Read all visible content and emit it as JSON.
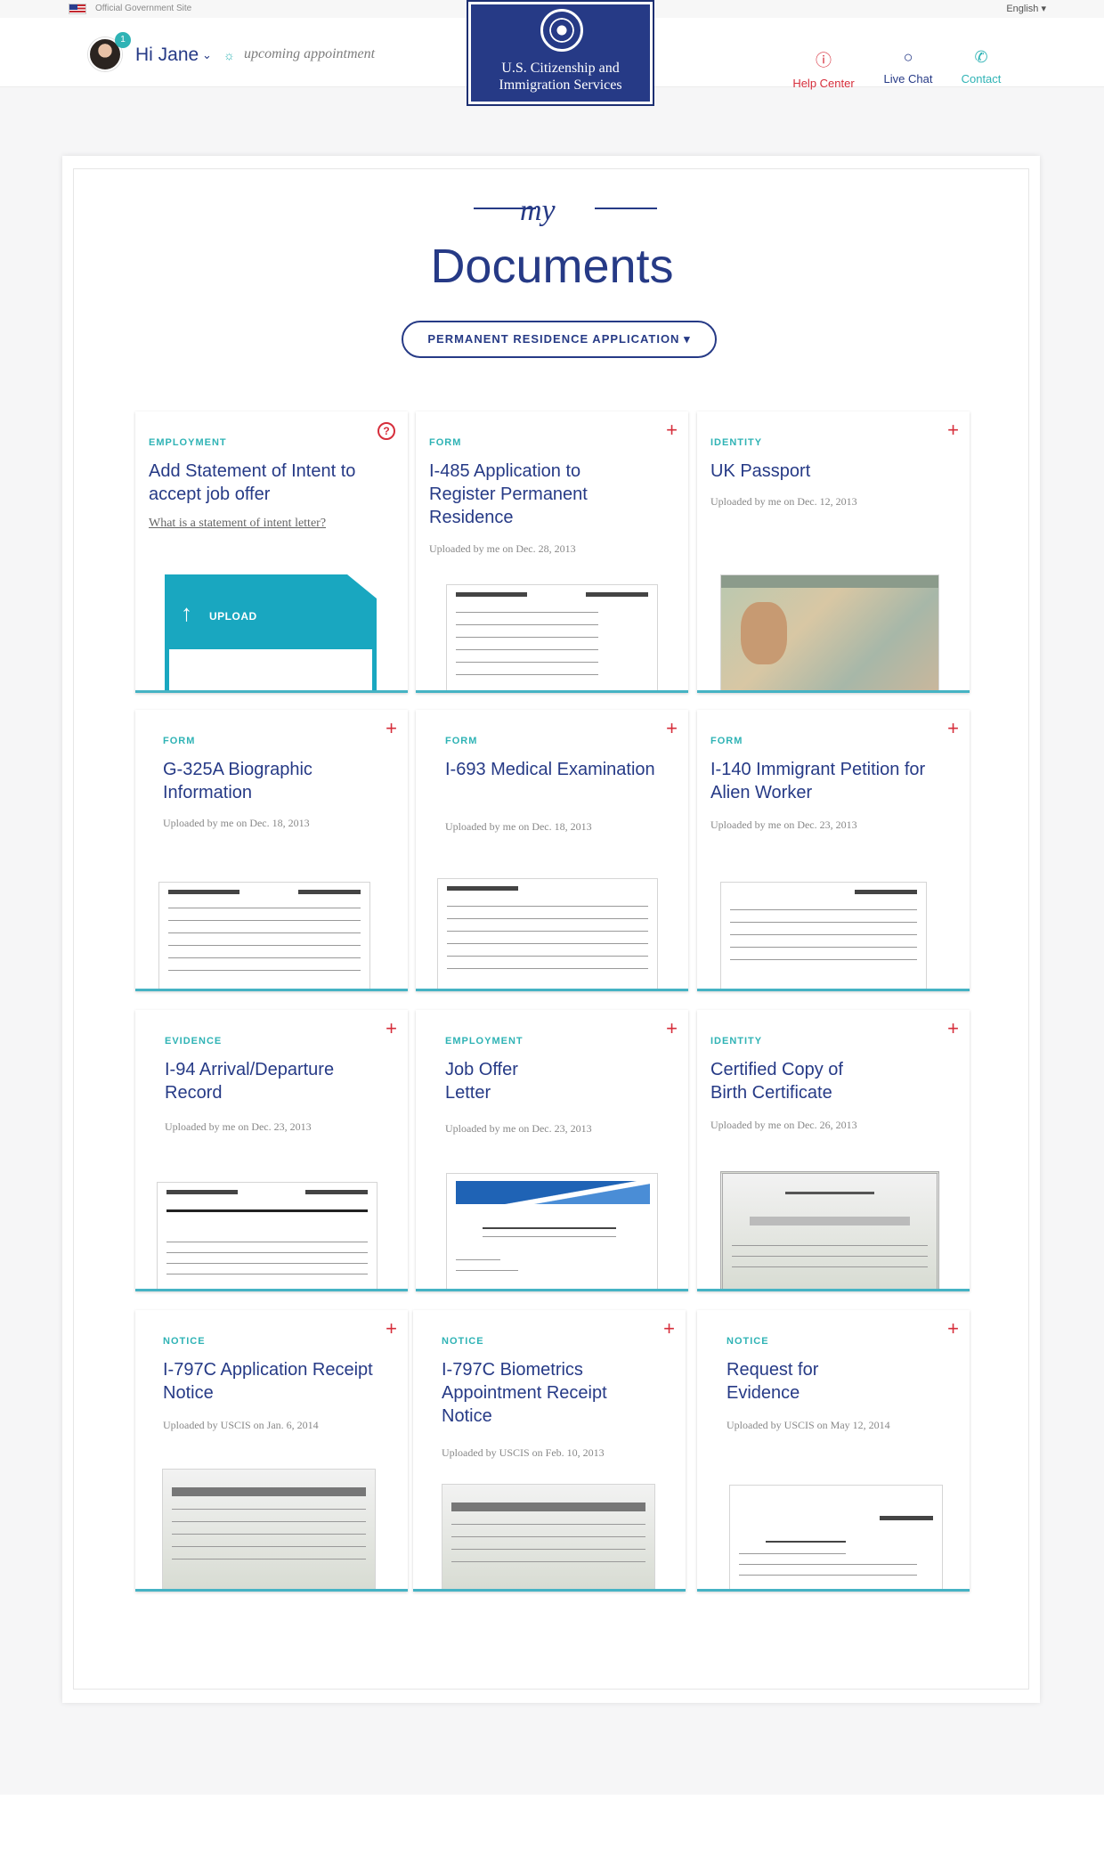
{
  "topbar": {
    "official": "Official Government Site",
    "language": "English"
  },
  "header": {
    "greeting": "Hi Jane",
    "notification_count": "1",
    "upcoming": "upcoming appointment",
    "agency_line1": "U.S. Citizenship and",
    "agency_line2": "Immigration Services",
    "nav": [
      {
        "label": "Help Center",
        "icon": "help-circle-icon",
        "color": "#d62e3b"
      },
      {
        "label": "Live Chat",
        "icon": "chat-bubble-icon",
        "color": "#263a86"
      },
      {
        "label": "Contact",
        "icon": "phone-icon",
        "color": "#2fb3b5"
      }
    ]
  },
  "page": {
    "script_word": "my",
    "title": "Documents",
    "filter_label": "PERMANENT RESIDENCE APPLICATION"
  },
  "colors": {
    "brand": "#263a86",
    "accent": "#2fb3b5",
    "alert": "#d62e3b",
    "upload": "#19a7c0"
  },
  "documents": [
    {
      "category": "EMPLOYMENT",
      "title": "Add Statement of Intent to accept job offer",
      "link": "What is a statement of intent letter?",
      "action": "UPLOAD"
    },
    {
      "category": "FORM",
      "title": "I-485 Application to Register Permanent Residence",
      "uploaded": "Uploaded by me on Dec. 28, 2013"
    },
    {
      "category": "IDENTITY",
      "title": "UK Passport",
      "uploaded": "Uploaded by me on Dec. 12, 2013"
    },
    {
      "category": "FORM",
      "title": "G-325A Biographic Information",
      "uploaded": "Uploaded by me on Dec. 18, 2013"
    },
    {
      "category": "FORM",
      "title": "I-693 Medical Examination",
      "uploaded": "Uploaded by me on Dec. 18, 2013"
    },
    {
      "category": "FORM",
      "title": "I-140 Immigrant Petition for Alien Worker",
      "uploaded": "Uploaded by me on Dec. 23, 2013"
    },
    {
      "category": "EVIDENCE",
      "title": "I-94 Arrival/Departure Record",
      "uploaded": "Uploaded by me on Dec. 23, 2013"
    },
    {
      "category": "EMPLOYMENT",
      "title": "Job Offer Letter",
      "uploaded": "Uploaded by me on Dec. 23, 2013"
    },
    {
      "category": "IDENTITY",
      "title": "Certified Copy of Birth Certificate",
      "uploaded": "Uploaded by me on Dec. 26, 2013"
    },
    {
      "category": "NOTICE",
      "title": "I-797C Application Receipt Notice",
      "uploaded": "Uploaded by USCIS on Jan. 6, 2014"
    },
    {
      "category": "NOTICE",
      "title": "I-797C Biometrics Appointment Receipt Notice",
      "uploaded": "Uploaded by USCIS on Feb. 10, 2013"
    },
    {
      "category": "NOTICE",
      "title": "Request for Evidence",
      "uploaded": "Uploaded by USCIS on May 12, 2014"
    }
  ]
}
